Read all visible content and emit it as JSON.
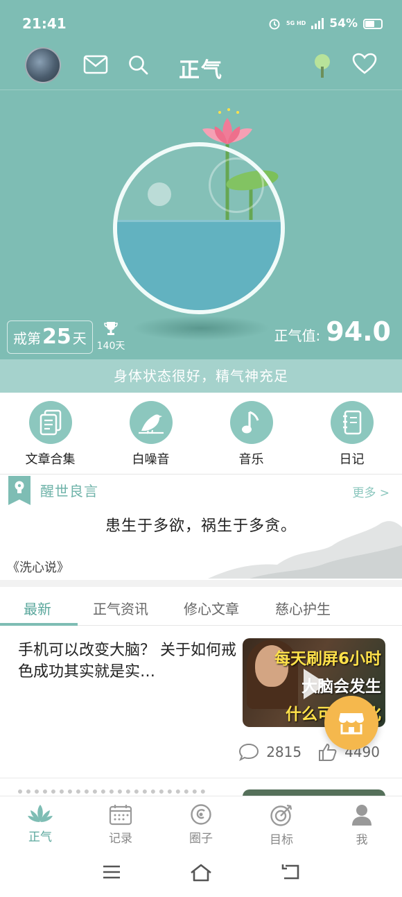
{
  "status_bar": {
    "time": "21:41",
    "network_top": "5G HD",
    "battery": "54%",
    "battery_level": 0.54
  },
  "header": {
    "title": "正气"
  },
  "hero": {
    "streak_prefix": "戒第",
    "streak_days": "25",
    "streak_suffix": "天",
    "best_record": "140天",
    "energy_label": "正气值:",
    "energy_value": "94.0",
    "status_message": "身体状态很好，精气神充足"
  },
  "quick_actions": [
    {
      "label": "文章合集",
      "icon": "document-icon"
    },
    {
      "label": "白噪音",
      "icon": "bird-icon"
    },
    {
      "label": "音乐",
      "icon": "music-note-icon"
    },
    {
      "label": "日记",
      "icon": "notebook-icon"
    }
  ],
  "quote": {
    "section_title": "醒世良言",
    "more_label": "更多 >",
    "text": "患生于多欲，祸生于多贪。",
    "source": "《洗心说》"
  },
  "tabs": [
    {
      "label": "最新",
      "active": true
    },
    {
      "label": "正气资讯",
      "active": false
    },
    {
      "label": "修心文章",
      "active": false
    },
    {
      "label": "慈心护生",
      "active": false
    }
  ],
  "article": {
    "title": "手机可以改变大脑？ 关于如何戒色成功其实就是实…",
    "thumb_line1": "每天刷屏6小时",
    "thumb_line2": "大脑会发生",
    "thumb_line3": "什么可怕变化",
    "comments": "2815",
    "likes": "4490"
  },
  "bottom_nav": [
    {
      "label": "正气",
      "icon": "lotus-icon",
      "active": true
    },
    {
      "label": "记录",
      "icon": "calendar-icon",
      "active": false
    },
    {
      "label": "圈子",
      "icon": "circle-icon",
      "active": false
    },
    {
      "label": "目标",
      "icon": "target-icon",
      "active": false
    },
    {
      "label": "我",
      "icon": "user-icon",
      "active": false
    }
  ],
  "colors": {
    "teal": "#7ebdb4",
    "teal_light": "#a5d2cc",
    "accent": "#5aa79c",
    "fab": "#f5b84d"
  }
}
